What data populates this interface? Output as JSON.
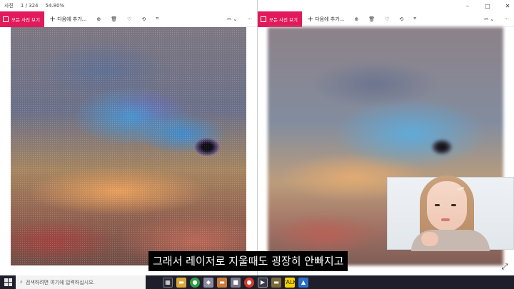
{
  "left_window": {
    "titlebar": {
      "app": "사진",
      "counter": "1 / 324",
      "zoom": "54.80%"
    },
    "toolbar": {
      "view_all_label": "모든 사진 보기",
      "add_label": "다음에 추가..."
    }
  },
  "right_window": {
    "toolbar": {
      "view_all_label": "모든 사진 보기",
      "add_label": "다음에 추가..."
    }
  },
  "subtitle": "그래서 레이저로 지울때도 굉장히 안빠지고",
  "taskbar": {
    "search_placeholder": "검색하려면 여기에 입력하십시오."
  },
  "colors": {
    "accent": "#e2195b",
    "taskbar": "#1f1f2b"
  },
  "icons": [
    "search-icon",
    "zoom-icon",
    "delete-icon",
    "favorite-icon",
    "rotate-icon",
    "crop-icon",
    "edit-icon",
    "more-icon"
  ]
}
